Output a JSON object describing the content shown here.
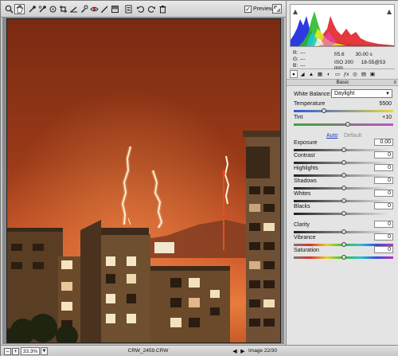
{
  "toolbar": {
    "tools": [
      {
        "name": "zoom-tool",
        "icon": "zoom-icon"
      },
      {
        "name": "hand-tool",
        "icon": "hand-icon"
      },
      {
        "name": "white-balance-tool",
        "icon": "eyedropper-icon"
      },
      {
        "name": "color-sampler-tool",
        "icon": "color-sampler-icon"
      },
      {
        "name": "target-adjustment-tool",
        "icon": "target-icon"
      },
      {
        "name": "crop-tool",
        "icon": "crop-icon"
      },
      {
        "name": "straighten-tool",
        "icon": "straighten-icon"
      },
      {
        "name": "spot-removal-tool",
        "icon": "spot-removal-icon"
      },
      {
        "name": "red-eye-tool",
        "icon": "red-eye-icon"
      },
      {
        "name": "adjustment-brush-tool",
        "icon": "brush-icon"
      },
      {
        "name": "graduated-filter-tool",
        "icon": "graduated-filter-icon"
      },
      {
        "name": "preferences-button",
        "icon": "list-icon"
      },
      {
        "name": "rotate-left-button",
        "icon": "rotate-left-icon"
      },
      {
        "name": "rotate-right-button",
        "icon": "rotate-right-icon"
      },
      {
        "name": "delete-button",
        "icon": "trash-icon"
      }
    ],
    "preview_label": "Preview",
    "preview_checked": true
  },
  "readouts": {
    "r_label": "R:",
    "r_value": "---",
    "g_label": "G:",
    "g_value": "---",
    "b_label": "B:",
    "b_value": "---",
    "aperture": "f/5.6",
    "shutter": "30.00 s",
    "iso": "ISO 200",
    "lens": "18-55@53 mm"
  },
  "panel": {
    "section_title": "Basic",
    "white_balance_label": "White Balance:",
    "white_balance_value": "Daylight",
    "auto_label": "Auto",
    "default_label": "Default",
    "sliders": [
      {
        "key": "temperature",
        "label": "Temperature",
        "value": "5500",
        "fraction": 0.3,
        "boxed": false,
        "track": "temperature"
      },
      {
        "key": "tint",
        "label": "Tint",
        "value": "+10",
        "fraction": 0.54,
        "boxed": false,
        "track": "tint"
      },
      {
        "key": "exposure",
        "label": "Exposure",
        "value": "0.00",
        "fraction": 0.5,
        "boxed": true,
        "track": "gray"
      },
      {
        "key": "contrast",
        "label": "Contrast",
        "value": "0",
        "fraction": 0.5,
        "boxed": true,
        "track": "gray"
      },
      {
        "key": "highlights",
        "label": "Highlights",
        "value": "0",
        "fraction": 0.5,
        "boxed": true,
        "track": "gray"
      },
      {
        "key": "shadows",
        "label": "Shadows",
        "value": "0",
        "fraction": 0.5,
        "boxed": true,
        "track": "gray"
      },
      {
        "key": "whites",
        "label": "Whites",
        "value": "0",
        "fraction": 0.5,
        "boxed": true,
        "track": "gray"
      },
      {
        "key": "blacks",
        "label": "Blacks",
        "value": "0",
        "fraction": 0.5,
        "boxed": true,
        "track": "gray"
      },
      {
        "key": "clarity",
        "label": "Clarity",
        "value": "0",
        "fraction": 0.5,
        "boxed": true,
        "track": "gray"
      },
      {
        "key": "vibrance",
        "label": "Vibrance",
        "value": "0",
        "fraction": 0.5,
        "boxed": true,
        "track": "saturation"
      },
      {
        "key": "saturation",
        "label": "Saturation",
        "value": "0",
        "fraction": 0.5,
        "boxed": true,
        "track": "saturation"
      }
    ]
  },
  "panel_tabs": [
    "basic-icon",
    "tone-curve-icon",
    "detail-icon",
    "hsl-icon",
    "split-toning-icon",
    "lens-corrections-icon",
    "fx-icon",
    "camera-calibration-icon",
    "presets-icon",
    "snapshots-icon"
  ],
  "statusbar": {
    "zoom_value": "33.3%",
    "filename": "CRW_2459.CRW",
    "image_counter": "Image 22/30"
  },
  "colors": {
    "sky_top": "#7a2a12",
    "sky_horizon": "#e0692a",
    "lightning": "#fff2dc",
    "building": "#4e3320"
  }
}
